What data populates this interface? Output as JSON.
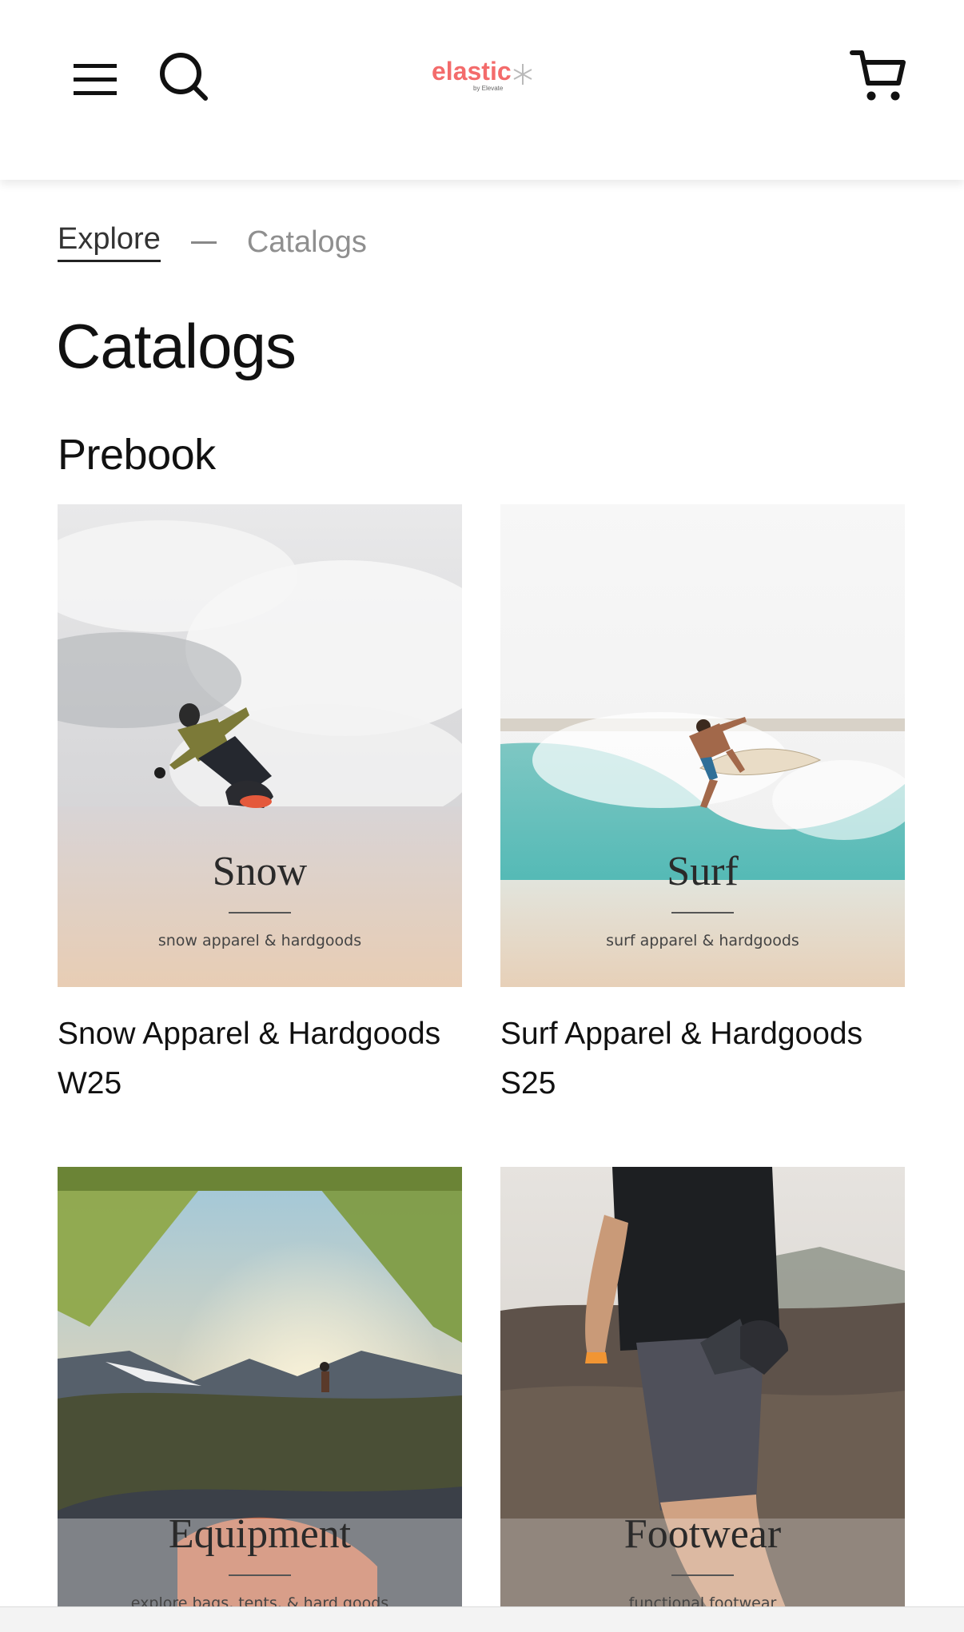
{
  "header": {
    "logo_text": "elastic",
    "logo_subtext": "by Elevate",
    "logo_color": "#ef3a3a"
  },
  "breadcrumb": {
    "items": [
      {
        "label": "Explore"
      },
      {
        "label": "Catalogs"
      }
    ]
  },
  "page": {
    "title": "Catalogs",
    "section_title": "Prebook"
  },
  "catalogs": [
    {
      "cover_title": "Snow",
      "cover_subtitle": "snow apparel & hardgoods",
      "name": "Snow Apparel & Hardgoods",
      "season": "W25"
    },
    {
      "cover_title": "Surf",
      "cover_subtitle": "surf apparel & hardgoods",
      "name": "Surf Apparel & Hardgoods",
      "season": "S25"
    },
    {
      "cover_title": "Equipment",
      "cover_subtitle": "explore bags, tents, & hard goods"
    },
    {
      "cover_title": "Footwear",
      "cover_subtitle": "functional footwear"
    }
  ],
  "icons": {
    "menu": "menu-icon",
    "search": "search-icon",
    "cart": "cart-icon"
  }
}
